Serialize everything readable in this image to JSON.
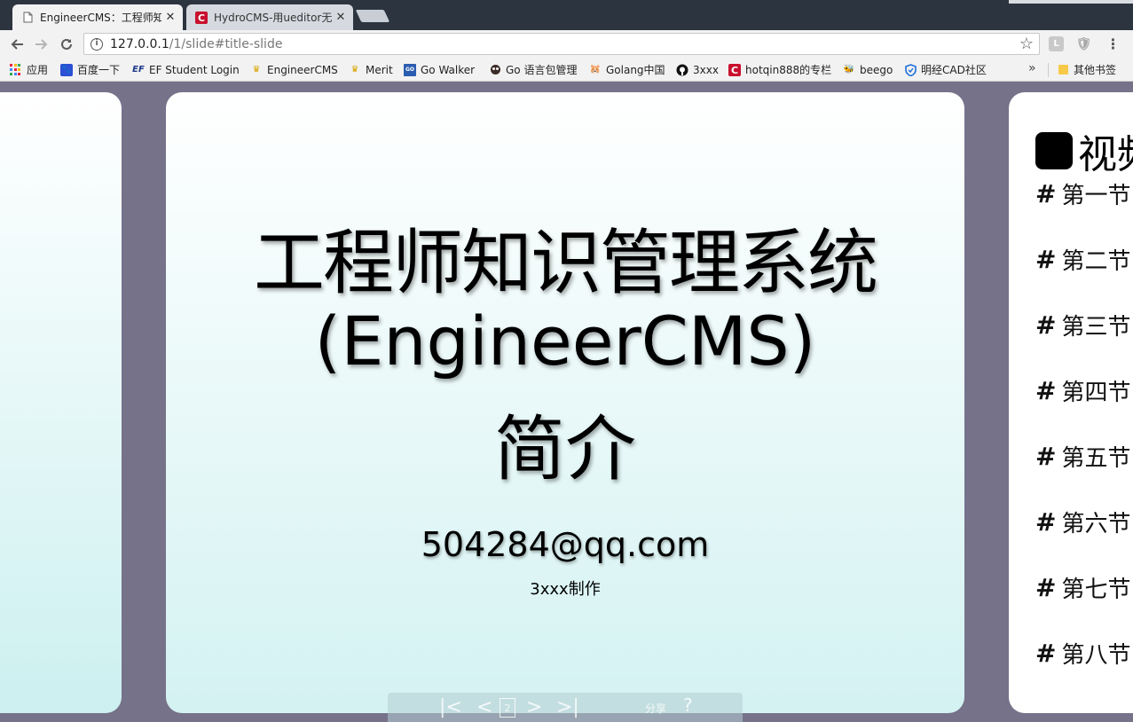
{
  "browser": {
    "tabs": [
      {
        "title": "EngineerCMS：工程师知",
        "active": true,
        "icon": "page-icon"
      },
      {
        "title": "HydroCMS-用ueditor无",
        "active": false,
        "icon": "cms-red-icon"
      }
    ],
    "close_glyph": "✕",
    "address": {
      "host": "127.0.0.1",
      "path": "/1/slide#title-slide"
    },
    "extensions": [
      "L",
      "🛡"
    ],
    "menu_glyph": "⋮"
  },
  "bookmarks": [
    {
      "label": "应用",
      "icon": "apps-grid-icon"
    },
    {
      "label": "百度一下",
      "icon": "baidu-paw-icon"
    },
    {
      "label": "EF Student Login",
      "icon": "ef-icon"
    },
    {
      "label": "EngineerCMS",
      "icon": "engineercms-icon"
    },
    {
      "label": "Merit",
      "icon": "merit-icon"
    },
    {
      "label": "Go Walker",
      "icon": "godoc-icon"
    },
    {
      "label": "Go 语言包管理",
      "icon": "gopher-icon"
    },
    {
      "label": "Golang中国",
      "icon": "golang-china-icon"
    },
    {
      "label": "3xxx",
      "icon": "github-icon"
    },
    {
      "label": "hotqin888的专栏",
      "icon": "csdn-icon"
    },
    {
      "label": "beego",
      "icon": "beego-icon"
    },
    {
      "label": "明经CAD社区",
      "icon": "shield-icon"
    }
  ],
  "bookmarks_more": "»",
  "other_bookmarks": "其他书签",
  "slide": {
    "title_line1": "工程师知识管理系统",
    "title_line2": "(EngineerCMS)",
    "title_line3": "简介",
    "email": "504284@qq.com",
    "author": "3xxx制作"
  },
  "next_slide": {
    "heading": "视频",
    "items": [
      "第一节",
      "第二节",
      "第三节",
      "第四节",
      "第五节",
      "第六节",
      "第七节",
      "第八节"
    ]
  },
  "controls": {
    "first": "|<",
    "prev": "<",
    "page": "2",
    "next": ">",
    "last": ">|",
    "share": "分享",
    "help": "?"
  }
}
